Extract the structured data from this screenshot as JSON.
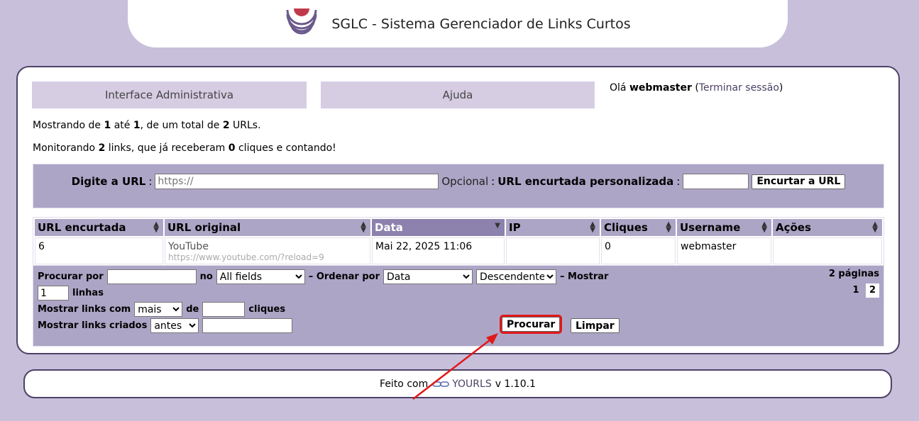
{
  "header": {
    "title": "SGLC - Sistema Gerenciador de Links Curtos"
  },
  "nav": {
    "admin": "Interface Administrativa",
    "help": "Ajuda"
  },
  "greeting": {
    "hello": "Olá",
    "user": "webmaster",
    "logout": "Terminar sessão"
  },
  "summary": {
    "showing_prefix": "Mostrando de",
    "from": "1",
    "to_word": "até",
    "to": "1",
    "total_word": ", de um total de",
    "total": "2",
    "urls_word": "URLs.",
    "monitor_prefix": "Monitorando",
    "links": "2",
    "links_word": "links, que já receberam",
    "clicks": "0",
    "clicks_word": "cliques e contando!"
  },
  "newurl": {
    "label": "Digite a URL",
    "placeholder": "https://",
    "optional": "Opcional",
    "custom_label": "URL encurtada personalizada",
    "submit": "Encurtar a URL"
  },
  "table": {
    "headers": [
      "URL encurtada",
      "URL original",
      "Data",
      "IP",
      "Cliques",
      "Username",
      "Ações"
    ],
    "rows": [
      {
        "short": "6",
        "title": "YouTube",
        "url": "https://www.youtube.com/?reload=9",
        "date": "Mai 22, 2025 11:06",
        "ip": "",
        "clicks": "0",
        "username": "webmaster",
        "actions": ""
      }
    ]
  },
  "filters": {
    "search_label": "Procurar por",
    "search_value": "",
    "in_label": "no",
    "in_value": "All fields",
    "order_label": "– Ordenar por",
    "order_value": "Data",
    "direction_value": "Descendente",
    "show_label": "– Mostrar",
    "rows_value": "1",
    "rows_label": "linhas",
    "clicks_label": "Mostrar links com",
    "clicks_op": "mais",
    "of_label": "de",
    "clicks_value": "",
    "clicks_unit": "cliques",
    "created_label": "Mostrar links criados",
    "created_op": "antes",
    "created_value": "",
    "pages_label": "2 páginas",
    "pages": [
      "1",
      "2"
    ],
    "search_button": "Procurar",
    "clear_button": "Limpar"
  },
  "footer": {
    "made_with": "Feito com",
    "link": "YOURLS",
    "version": "v 1.10.1"
  },
  "colors": {
    "accent": "#4d4166",
    "panel": "#ada5c6",
    "highlight": "#e01919"
  }
}
